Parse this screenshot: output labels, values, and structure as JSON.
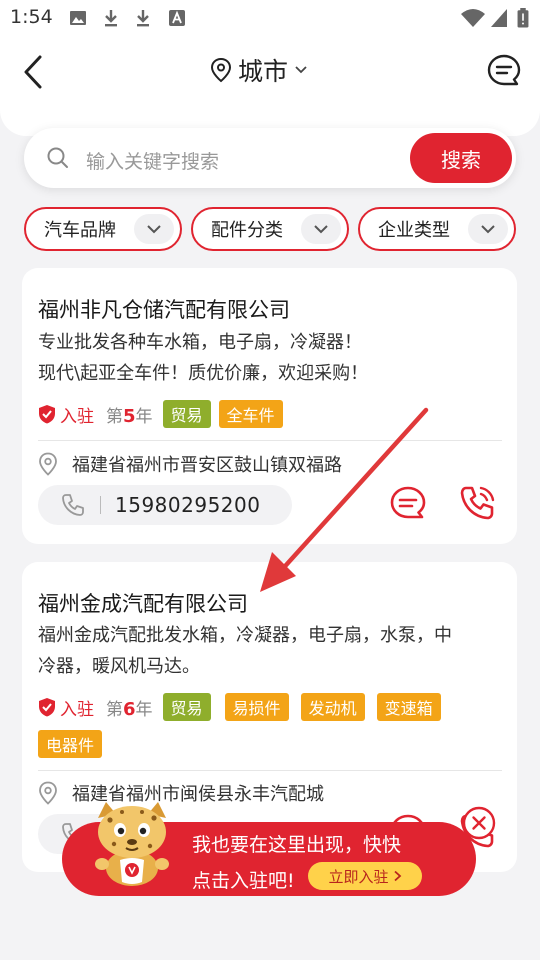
{
  "status_bar": {
    "time": "1:54"
  },
  "header": {
    "city_label": "城市"
  },
  "search": {
    "placeholder": "输入关键字搜索",
    "button_label": "搜索"
  },
  "filters": [
    {
      "label": "汽车品牌"
    },
    {
      "label": "配件分类"
    },
    {
      "label": "企业类型"
    }
  ],
  "companies": [
    {
      "name": "福州非凡仓储汽配有限公司",
      "desc_lines": [
        "专业批发各种车水箱，电子扇，冷凝器！",
        "现代\\起亚全车件！质优价廉，欢迎采购！"
      ],
      "ruzhu": "入驻",
      "years_prefix": "第",
      "years_num": "5",
      "years_suffix": "年",
      "tags": [
        {
          "label": "贸易",
          "color": "green"
        },
        {
          "label": "全车件",
          "color": "orange"
        }
      ],
      "address": "福建省福州市晋安区鼓山镇双福路",
      "phone": "15980295200"
    },
    {
      "name": "福州金成汽配有限公司",
      "desc_lines": [
        "福州金成汽配批发水箱，冷凝器，电子扇，水泵，中",
        "冷器，暖风机马达。"
      ],
      "ruzhu": "入驻",
      "years_prefix": "第",
      "years_num": "6",
      "years_suffix": "年",
      "tags": [
        {
          "label": "贸易",
          "color": "green"
        },
        {
          "label": "易损件",
          "color": "orange"
        },
        {
          "label": "发动机",
          "color": "orange"
        },
        {
          "label": "变速箱",
          "color": "orange"
        },
        {
          "label": "电器件",
          "color": "orange"
        }
      ],
      "address": "福建省福州市闽侯县永丰汽配城"
    }
  ],
  "promo": {
    "line1": "我也要在这里出现，快快",
    "line2": "点击入驻吧!",
    "button_label": "立即入驻"
  },
  "colors": {
    "accent": "#e02430",
    "tag_green": "#8fae2c",
    "tag_orange": "#f3a417",
    "promo_button": "#ffd24a"
  }
}
